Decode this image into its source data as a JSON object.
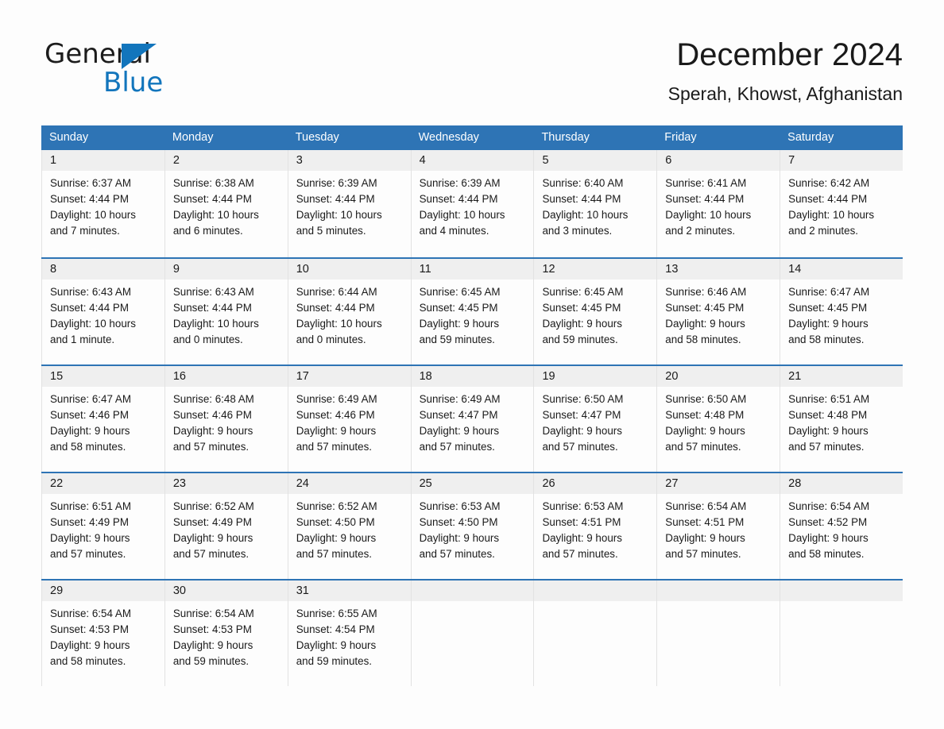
{
  "logo": {
    "text_top": "General",
    "text_bottom": "Blue",
    "triangle_color": "#1275bc",
    "blue_color": "#1275bc"
  },
  "header": {
    "title": "December 2024",
    "location": "Sperah, Khowst, Afghanistan"
  },
  "theme": {
    "header_blue": "#2e74b5",
    "row_separator": "#2e74b5",
    "daynum_band": "#efefef",
    "page_background": "#fdfdfd",
    "text": "#1a1a1a"
  },
  "weekdays": [
    "Sunday",
    "Monday",
    "Tuesday",
    "Wednesday",
    "Thursday",
    "Friday",
    "Saturday"
  ],
  "weeks": [
    [
      {
        "day": "1",
        "sunrise": "Sunrise: 6:37 AM",
        "sunset": "Sunset: 4:44 PM",
        "daylight1": "Daylight: 10 hours",
        "daylight2": "and 7 minutes."
      },
      {
        "day": "2",
        "sunrise": "Sunrise: 6:38 AM",
        "sunset": "Sunset: 4:44 PM",
        "daylight1": "Daylight: 10 hours",
        "daylight2": "and 6 minutes."
      },
      {
        "day": "3",
        "sunrise": "Sunrise: 6:39 AM",
        "sunset": "Sunset: 4:44 PM",
        "daylight1": "Daylight: 10 hours",
        "daylight2": "and 5 minutes."
      },
      {
        "day": "4",
        "sunrise": "Sunrise: 6:39 AM",
        "sunset": "Sunset: 4:44 PM",
        "daylight1": "Daylight: 10 hours",
        "daylight2": "and 4 minutes."
      },
      {
        "day": "5",
        "sunrise": "Sunrise: 6:40 AM",
        "sunset": "Sunset: 4:44 PM",
        "daylight1": "Daylight: 10 hours",
        "daylight2": "and 3 minutes."
      },
      {
        "day": "6",
        "sunrise": "Sunrise: 6:41 AM",
        "sunset": "Sunset: 4:44 PM",
        "daylight1": "Daylight: 10 hours",
        "daylight2": "and 2 minutes."
      },
      {
        "day": "7",
        "sunrise": "Sunrise: 6:42 AM",
        "sunset": "Sunset: 4:44 PM",
        "daylight1": "Daylight: 10 hours",
        "daylight2": "and 2 minutes."
      }
    ],
    [
      {
        "day": "8",
        "sunrise": "Sunrise: 6:43 AM",
        "sunset": "Sunset: 4:44 PM",
        "daylight1": "Daylight: 10 hours",
        "daylight2": "and 1 minute."
      },
      {
        "day": "9",
        "sunrise": "Sunrise: 6:43 AM",
        "sunset": "Sunset: 4:44 PM",
        "daylight1": "Daylight: 10 hours",
        "daylight2": "and 0 minutes."
      },
      {
        "day": "10",
        "sunrise": "Sunrise: 6:44 AM",
        "sunset": "Sunset: 4:44 PM",
        "daylight1": "Daylight: 10 hours",
        "daylight2": "and 0 minutes."
      },
      {
        "day": "11",
        "sunrise": "Sunrise: 6:45 AM",
        "sunset": "Sunset: 4:45 PM",
        "daylight1": "Daylight: 9 hours",
        "daylight2": "and 59 minutes."
      },
      {
        "day": "12",
        "sunrise": "Sunrise: 6:45 AM",
        "sunset": "Sunset: 4:45 PM",
        "daylight1": "Daylight: 9 hours",
        "daylight2": "and 59 minutes."
      },
      {
        "day": "13",
        "sunrise": "Sunrise: 6:46 AM",
        "sunset": "Sunset: 4:45 PM",
        "daylight1": "Daylight: 9 hours",
        "daylight2": "and 58 minutes."
      },
      {
        "day": "14",
        "sunrise": "Sunrise: 6:47 AM",
        "sunset": "Sunset: 4:45 PM",
        "daylight1": "Daylight: 9 hours",
        "daylight2": "and 58 minutes."
      }
    ],
    [
      {
        "day": "15",
        "sunrise": "Sunrise: 6:47 AM",
        "sunset": "Sunset: 4:46 PM",
        "daylight1": "Daylight: 9 hours",
        "daylight2": "and 58 minutes."
      },
      {
        "day": "16",
        "sunrise": "Sunrise: 6:48 AM",
        "sunset": "Sunset: 4:46 PM",
        "daylight1": "Daylight: 9 hours",
        "daylight2": "and 57 minutes."
      },
      {
        "day": "17",
        "sunrise": "Sunrise: 6:49 AM",
        "sunset": "Sunset: 4:46 PM",
        "daylight1": "Daylight: 9 hours",
        "daylight2": "and 57 minutes."
      },
      {
        "day": "18",
        "sunrise": "Sunrise: 6:49 AM",
        "sunset": "Sunset: 4:47 PM",
        "daylight1": "Daylight: 9 hours",
        "daylight2": "and 57 minutes."
      },
      {
        "day": "19",
        "sunrise": "Sunrise: 6:50 AM",
        "sunset": "Sunset: 4:47 PM",
        "daylight1": "Daylight: 9 hours",
        "daylight2": "and 57 minutes."
      },
      {
        "day": "20",
        "sunrise": "Sunrise: 6:50 AM",
        "sunset": "Sunset: 4:48 PM",
        "daylight1": "Daylight: 9 hours",
        "daylight2": "and 57 minutes."
      },
      {
        "day": "21",
        "sunrise": "Sunrise: 6:51 AM",
        "sunset": "Sunset: 4:48 PM",
        "daylight1": "Daylight: 9 hours",
        "daylight2": "and 57 minutes."
      }
    ],
    [
      {
        "day": "22",
        "sunrise": "Sunrise: 6:51 AM",
        "sunset": "Sunset: 4:49 PM",
        "daylight1": "Daylight: 9 hours",
        "daylight2": "and 57 minutes."
      },
      {
        "day": "23",
        "sunrise": "Sunrise: 6:52 AM",
        "sunset": "Sunset: 4:49 PM",
        "daylight1": "Daylight: 9 hours",
        "daylight2": "and 57 minutes."
      },
      {
        "day": "24",
        "sunrise": "Sunrise: 6:52 AM",
        "sunset": "Sunset: 4:50 PM",
        "daylight1": "Daylight: 9 hours",
        "daylight2": "and 57 minutes."
      },
      {
        "day": "25",
        "sunrise": "Sunrise: 6:53 AM",
        "sunset": "Sunset: 4:50 PM",
        "daylight1": "Daylight: 9 hours",
        "daylight2": "and 57 minutes."
      },
      {
        "day": "26",
        "sunrise": "Sunrise: 6:53 AM",
        "sunset": "Sunset: 4:51 PM",
        "daylight1": "Daylight: 9 hours",
        "daylight2": "and 57 minutes."
      },
      {
        "day": "27",
        "sunrise": "Sunrise: 6:54 AM",
        "sunset": "Sunset: 4:51 PM",
        "daylight1": "Daylight: 9 hours",
        "daylight2": "and 57 minutes."
      },
      {
        "day": "28",
        "sunrise": "Sunrise: 6:54 AM",
        "sunset": "Sunset: 4:52 PM",
        "daylight1": "Daylight: 9 hours",
        "daylight2": "and 58 minutes."
      }
    ],
    [
      {
        "day": "29",
        "sunrise": "Sunrise: 6:54 AM",
        "sunset": "Sunset: 4:53 PM",
        "daylight1": "Daylight: 9 hours",
        "daylight2": "and 58 minutes."
      },
      {
        "day": "30",
        "sunrise": "Sunrise: 6:54 AM",
        "sunset": "Sunset: 4:53 PM",
        "daylight1": "Daylight: 9 hours",
        "daylight2": "and 59 minutes."
      },
      {
        "day": "31",
        "sunrise": "Sunrise: 6:55 AM",
        "sunset": "Sunset: 4:54 PM",
        "daylight1": "Daylight: 9 hours",
        "daylight2": "and 59 minutes."
      },
      {
        "day": "",
        "sunrise": "",
        "sunset": "",
        "daylight1": "",
        "daylight2": ""
      },
      {
        "day": "",
        "sunrise": "",
        "sunset": "",
        "daylight1": "",
        "daylight2": ""
      },
      {
        "day": "",
        "sunrise": "",
        "sunset": "",
        "daylight1": "",
        "daylight2": ""
      },
      {
        "day": "",
        "sunrise": "",
        "sunset": "",
        "daylight1": "",
        "daylight2": ""
      }
    ]
  ]
}
